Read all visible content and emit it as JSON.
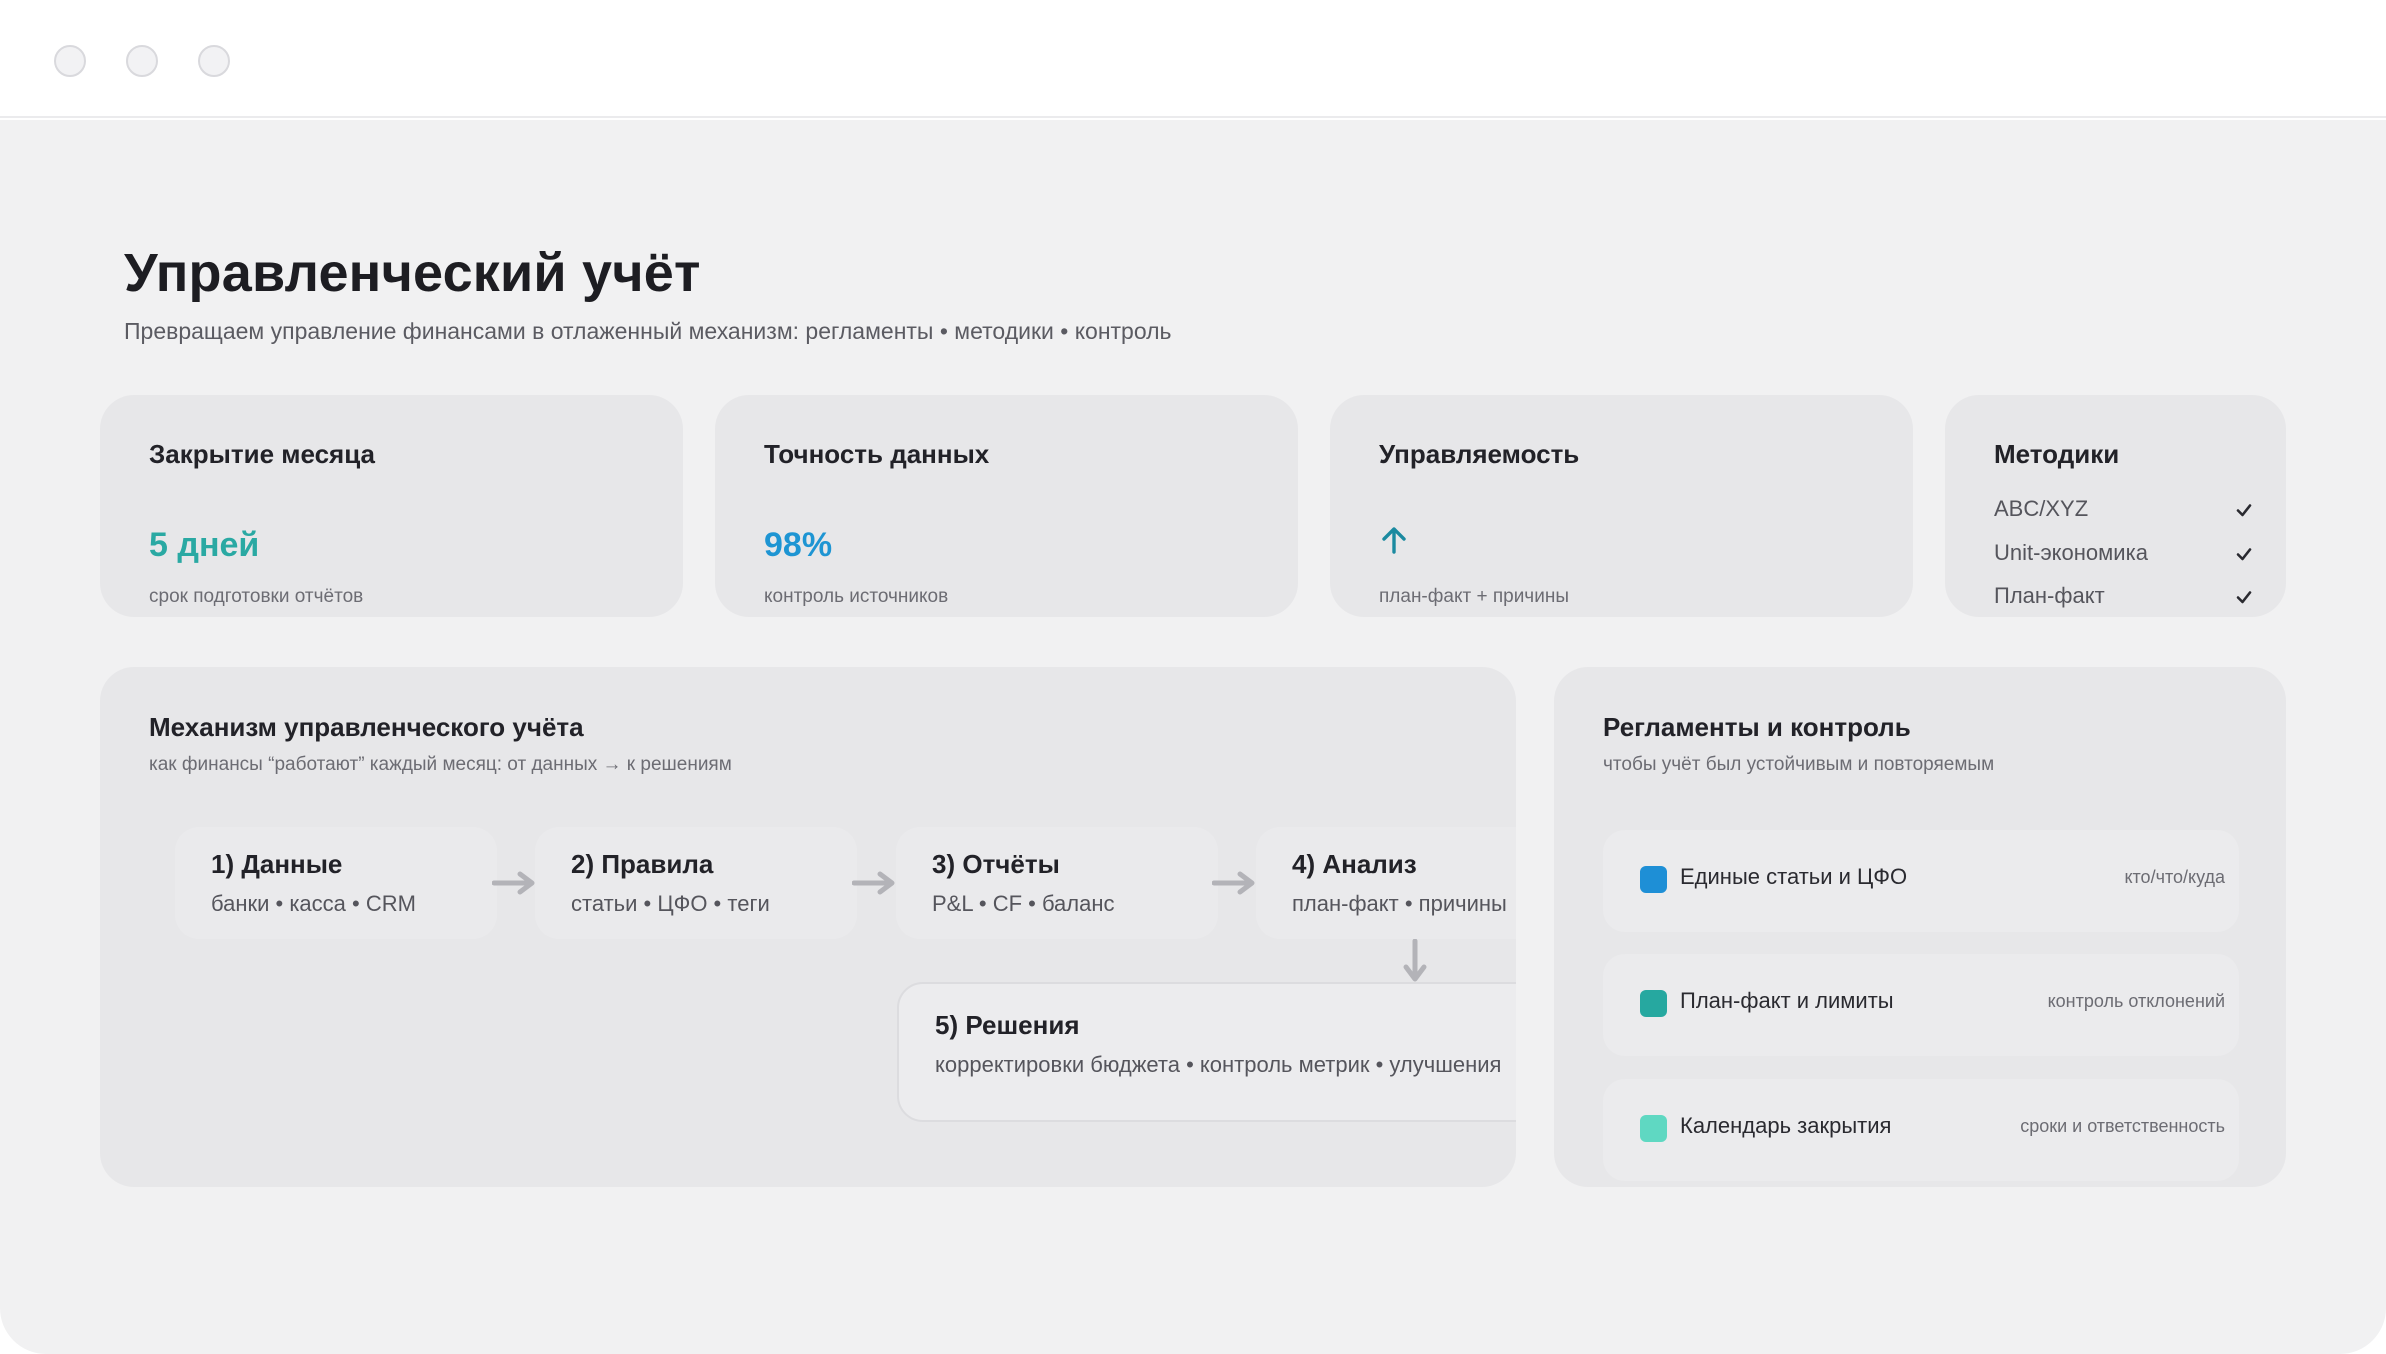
{
  "window": {
    "controls": [
      "close",
      "minimize",
      "maximize"
    ]
  },
  "page": {
    "title": "Управленческий учёт",
    "subtitle": "Превращаем управление финансами в отлаженный механизм: регламенты • методики • контроль"
  },
  "kpis": [
    {
      "title": "Закрытие месяца",
      "value": "5 дней",
      "caption": "срок подготовки отчётов",
      "color": "#2aa9a3"
    },
    {
      "title": "Точность данных",
      "value": "98%",
      "caption": "контроль источников",
      "color": "#1e95d3"
    },
    {
      "title": "Управляемость",
      "icon": "arrow-up-icon",
      "caption": "план-факт + причины",
      "color": "#1b8aa0"
    }
  ],
  "methods": {
    "title": "Методики",
    "items": [
      {
        "label": "ABC/XYZ",
        "checked": true
      },
      {
        "label": "Unit-экономика",
        "checked": true
      },
      {
        "label": "План-факт",
        "checked": true
      }
    ]
  },
  "mechanism": {
    "title": "Механизм управленческого учёта",
    "subtitle": "как финансы “работают” каждый месяц: от данных → к решениям",
    "steps": [
      {
        "title": "1) Данные",
        "sub": "банки • касса • CRM"
      },
      {
        "title": "2) Правила",
        "sub": "статьи • ЦФО • теги"
      },
      {
        "title": "3) Отчёты",
        "sub": "P&L • CF • баланс"
      },
      {
        "title": "4) Анализ",
        "sub": "план-факт • причины"
      }
    ],
    "final": {
      "title": "5) Решения",
      "sub": "корректировки бюджета • контроль метрик • улучшения"
    }
  },
  "regulations": {
    "title": "Регламенты и контроль",
    "subtitle": "чтобы учёт был устойчивым и повторяемым",
    "items": [
      {
        "label": "Единые статьи и ЦФО",
        "note": "кто/что/куда",
        "color": "#1e8fd6"
      },
      {
        "label": "План-факт и лимиты",
        "note": "контроль отклонений",
        "color": "#26a8a0"
      },
      {
        "label": "Календарь закрытия",
        "note": "сроки и ответственность",
        "color": "#5fd8c2"
      }
    ]
  }
}
